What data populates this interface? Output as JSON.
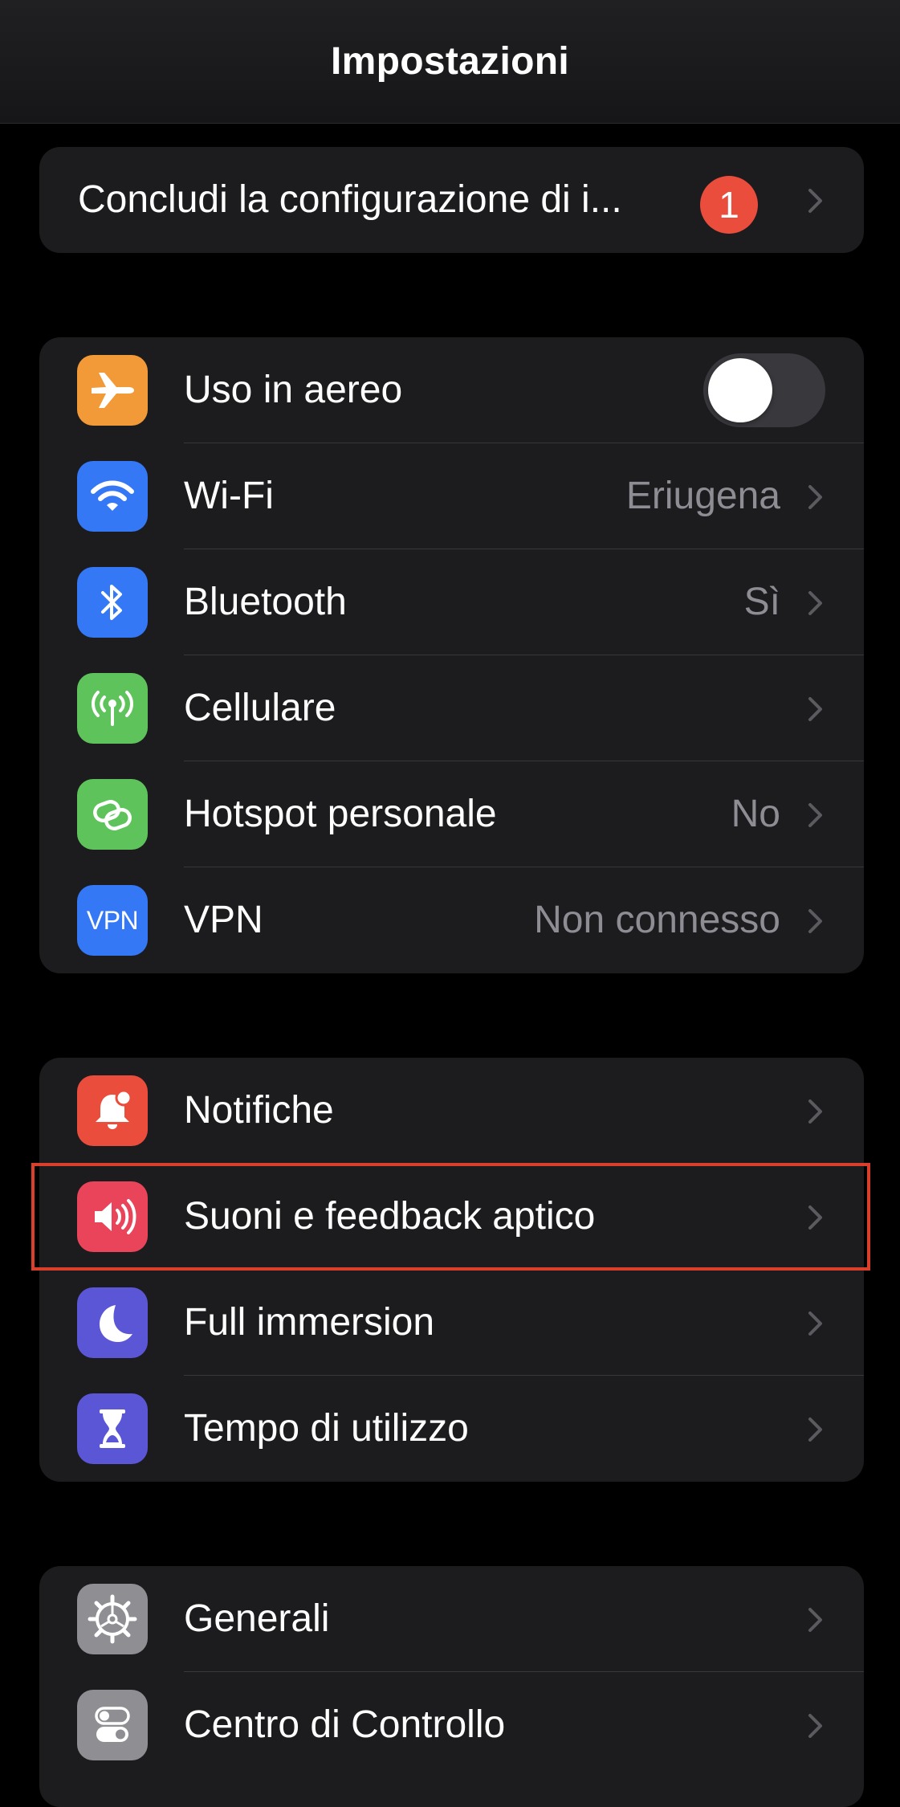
{
  "header": {
    "title": "Impostazioni"
  },
  "setup": {
    "label": "Concludi la configurazione di i...",
    "badge": "1"
  },
  "network": [
    {
      "id": "airplane",
      "label": "Uso in aereo",
      "icon": "airplane-icon",
      "color": "#f19a37",
      "toggle": "off"
    },
    {
      "id": "wifi",
      "label": "Wi-Fi",
      "value": "Eriugena",
      "icon": "wifi-icon",
      "color": "#3478f6"
    },
    {
      "id": "bluetooth",
      "label": "Bluetooth",
      "value": "Sì",
      "icon": "bluetooth-icon",
      "color": "#3478f6"
    },
    {
      "id": "cellular",
      "label": "Cellulare",
      "value": "",
      "icon": "antenna-icon",
      "color": "#5ec35a"
    },
    {
      "id": "hotspot",
      "label": "Hotspot personale",
      "value": "No",
      "icon": "hotspot-chain-icon",
      "color": "#5ec35a"
    },
    {
      "id": "vpn",
      "label": "VPN",
      "value": "Non connesso",
      "icon": "vpn-icon",
      "icon_text": "VPN",
      "color": "#3478f6"
    }
  ],
  "system": [
    {
      "id": "notifications",
      "label": "Notifiche",
      "icon": "bell-icon",
      "color": "#eb4d3d"
    },
    {
      "id": "sounds",
      "label": "Suoni e feedback aptico",
      "icon": "speaker-icon",
      "color": "#e9445a",
      "highlighted": true
    },
    {
      "id": "focus",
      "label": "Full immersion",
      "icon": "moon-icon",
      "color": "#5b56d6"
    },
    {
      "id": "screentime",
      "label": "Tempo di utilizzo",
      "icon": "hourglass-icon",
      "color": "#5b56d6"
    }
  ],
  "general": [
    {
      "id": "general",
      "label": "Generali",
      "icon": "gear-icon",
      "color": "#8e8e93"
    },
    {
      "id": "control",
      "label": "Centro di Controllo",
      "icon": "switches-icon",
      "color": "#8e8e93"
    }
  ],
  "colors": {
    "background": "#000000",
    "group": "#1c1c1e",
    "highlight": "#d93f2a",
    "secondary_text": "#8d8d93"
  }
}
